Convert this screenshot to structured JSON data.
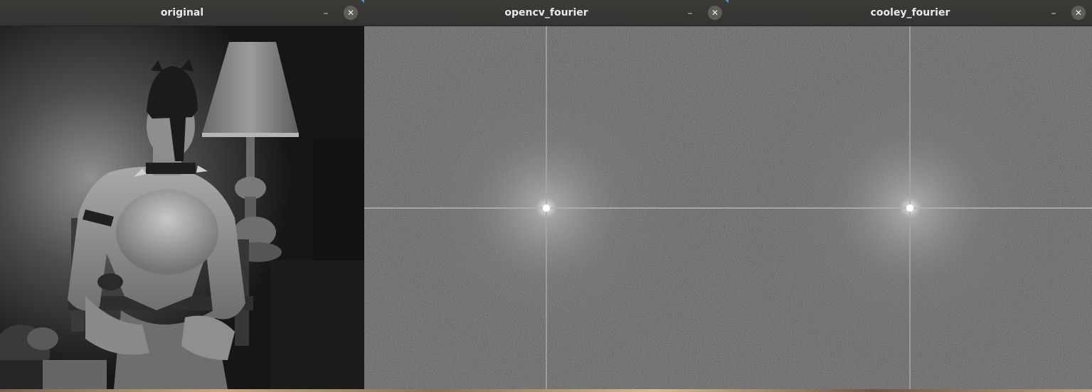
{
  "windows": [
    {
      "title": "original",
      "minimize_glyph": "–",
      "close_glyph": "✕",
      "content": "photo",
      "icons": [
        "minimize-icon",
        "close-icon"
      ]
    },
    {
      "title": "opencv_fourier",
      "minimize_glyph": "–",
      "close_glyph": "✕",
      "content": "fourier-spectrum",
      "icons": [
        "minimize-icon",
        "close-icon"
      ]
    },
    {
      "title": "cooley_fourier",
      "minimize_glyph": "–",
      "close_glyph": "✕",
      "content": "fourier-spectrum",
      "icons": [
        "minimize-icon",
        "close-icon"
      ]
    }
  ],
  "colors": {
    "titlebar": "#383634",
    "title_text": "#e9e9e9",
    "close_button": "#5f5d5a",
    "spectrum_base": "#5c5c5c",
    "accent_marker": "#5b8fc9"
  }
}
